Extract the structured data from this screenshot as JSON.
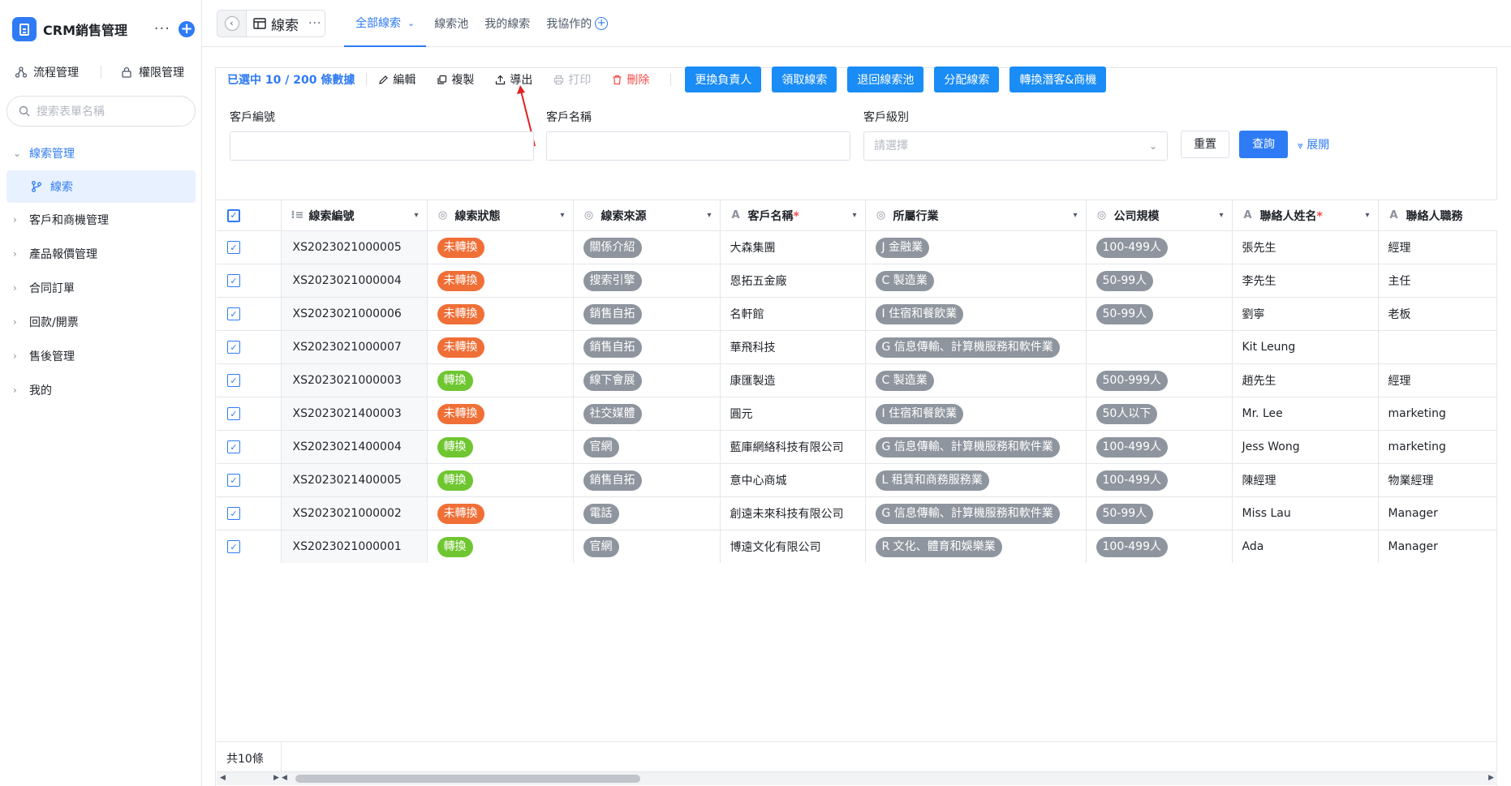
{
  "app": {
    "title": "CRM銷售管理",
    "brand_color": "#2f7bf5"
  },
  "sidebar": {
    "tools": [
      "流程管理",
      "權限管理"
    ],
    "search_placeholder": "搜索表單名稱",
    "nav": [
      {
        "label": "線索管理",
        "state": "open"
      },
      {
        "label": "線索",
        "state": "active"
      },
      {
        "label": "客戶和商機管理"
      },
      {
        "label": "產品報價管理"
      },
      {
        "label": "合同訂單"
      },
      {
        "label": "回款/開票"
      },
      {
        "label": "售後管理"
      },
      {
        "label": "我的"
      }
    ]
  },
  "topbar": {
    "page_title": "線索",
    "views": [
      "全部線索",
      "線索池",
      "我的線索",
      "我協作的"
    ]
  },
  "toolbar": {
    "selected": "已選中 10 / 200 條數據",
    "actions": [
      "編輯",
      "複製",
      "導出",
      "打印",
      "刪除"
    ],
    "primary": [
      "更換負責人",
      "領取線索",
      "退回線索池",
      "分配線索",
      "轉換潛客&商機"
    ]
  },
  "filters": {
    "labels": [
      "客戶編號",
      "客戶名稱",
      "客戶級別"
    ],
    "select_placeholder": "請選擇",
    "reset": "重置",
    "query": "查詢",
    "expand": "展開"
  },
  "table": {
    "columns": [
      "線索編號",
      "線索狀態",
      "線索來源",
      "客戶名稱",
      "所屬行業",
      "公司規模",
      "聯絡人姓名",
      "聯絡人職務"
    ],
    "rows": [
      {
        "code": "XS2023021000005",
        "status": "未轉換",
        "source": "關係介紹",
        "customer": "大森集團",
        "industry": "J 金融業",
        "size": "100-499人",
        "contact": "張先生",
        "title": "經理"
      },
      {
        "code": "XS2023021000004",
        "status": "未轉換",
        "source": "搜索引擎",
        "customer": "恩拓五金廠",
        "industry": "C 製造業",
        "size": "50-99人",
        "contact": "李先生",
        "title": "主任"
      },
      {
        "code": "XS2023021000006",
        "status": "未轉換",
        "source": "銷售自拓",
        "customer": "名軒館",
        "industry": "I 住宿和餐飲業",
        "size": "50-99人",
        "contact": "劉寧",
        "title": "老板"
      },
      {
        "code": "XS2023021000007",
        "status": "未轉換",
        "source": "銷售自拓",
        "customer": "華飛科技",
        "industry": "G 信息傳輸、計算機服務和軟件業",
        "size": "",
        "contact": "Kit Leung",
        "title": ""
      },
      {
        "code": "XS2023021000003",
        "status": "轉換",
        "source": "線下會展",
        "customer": "康匯製造",
        "industry": "C 製造業",
        "size": "500-999人",
        "contact": "趙先生",
        "title": "經理"
      },
      {
        "code": "XS2023021400003",
        "status": "未轉換",
        "source": "社交媒體",
        "customer": "圓元",
        "industry": "I 住宿和餐飲業",
        "size": "50人以下",
        "contact": "Mr. Lee",
        "title": "marketing"
      },
      {
        "code": "XS2023021400004",
        "status": "轉換",
        "source": "官網",
        "customer": "藍庫網絡科技有限公司",
        "industry": "G 信息傳輸、計算機服務和軟件業",
        "size": "100-499人",
        "contact": "Jess Wong",
        "title": "marketing"
      },
      {
        "code": "XS2023021400005",
        "status": "轉換",
        "source": "銷售自拓",
        "customer": "意中心商城",
        "industry": "L 租賃和商務服務業",
        "size": "100-499人",
        "contact": "陳經理",
        "title": "物業經理"
      },
      {
        "code": "XS2023021000002",
        "status": "未轉換",
        "source": "電話",
        "customer": "創遠未來科技有限公司",
        "industry": "G 信息傳輸、計算機服務和軟件業",
        "size": "50-99人",
        "contact": "Miss Lau",
        "title": "Manager"
      },
      {
        "code": "XS2023021000001",
        "status": "轉換",
        "source": "官網",
        "customer": "博遠文化有限公司",
        "industry": "R 文化、體育和娛樂業",
        "size": "100-499人",
        "contact": "Ada",
        "title": "Manager"
      }
    ],
    "total": "共10條"
  },
  "colors": {
    "unconverted": "#f06f37",
    "converted": "#6fc631",
    "neutral_tag": "#8f959e",
    "primary_button": "#1a8cf5",
    "danger": "#f54a45",
    "annotation_arrow": "#e02020"
  }
}
